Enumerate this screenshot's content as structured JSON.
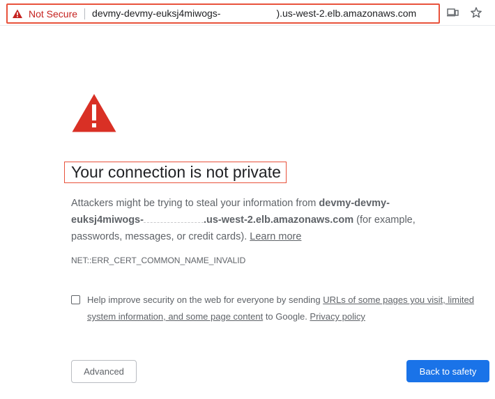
{
  "addressbar": {
    "security_label": "Not Secure",
    "url_before_redaction": "devmy-devmy-euksj4miwogs-",
    "url_after_redaction": ").us-west-2.elb.amazonaws.com",
    "icons": [
      "warning-triangle-icon",
      "install-app-icon",
      "star-icon"
    ]
  },
  "page": {
    "headline": "Your connection is not private",
    "explanation": {
      "prefix": "Attackers might be trying to steal your information from ",
      "host_part1": "devmy-devmy-",
      "host_part2": "euksj4miwogs-",
      "host_part3": ".us-west-2.elb.amazonaws.com",
      "suffix": " (for example, passwords, messages, or credit cards). ",
      "learn_more": "Learn more"
    },
    "error_code": "NET::ERR_CERT_COMMON_NAME_INVALID",
    "optin": {
      "text_before": "Help improve security on the web for everyone by sending ",
      "link_urls": "URLs of some pages you visit, limited system information, and some page content",
      "text_middle": " to Google. ",
      "link_privacy": "Privacy policy",
      "checked": false
    },
    "buttons": {
      "advanced": "Advanced",
      "back_to_safety": "Back to safety"
    },
    "colors": {
      "warning_red": "#d93025",
      "primary_blue": "#1a73e8",
      "annotation_red": "#e8523b"
    }
  }
}
